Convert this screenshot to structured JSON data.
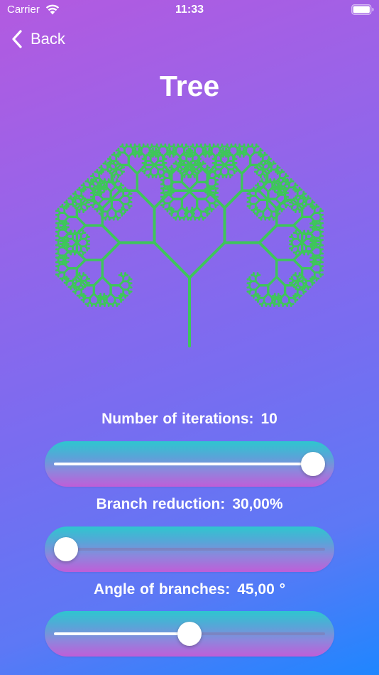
{
  "status_bar": {
    "carrier": "Carrier",
    "time": "11:33",
    "icons": [
      "wifi-icon",
      "battery-icon"
    ]
  },
  "nav": {
    "back_label": "Back",
    "back_icon": "chevron-left-icon"
  },
  "page": {
    "title": "Tree"
  },
  "tree": {
    "color": "#3ec65a",
    "icon": "fractal-tree-illustration"
  },
  "controls": [
    {
      "label": "Number of iterations:",
      "value": "10",
      "fraction": 1.0
    },
    {
      "label": "Branch reduction:",
      "value": "30,00%",
      "fraction": 0.0
    },
    {
      "label": "Angle of branches:",
      "value": "45,00  °",
      "fraction": 0.5
    }
  ],
  "colors": {
    "background_top": "#b35ae0",
    "background_bottom": "#1f86ff",
    "slider_top": "#2ec6cf",
    "slider_bottom": "#bf5ed8",
    "text": "#ffffff"
  }
}
